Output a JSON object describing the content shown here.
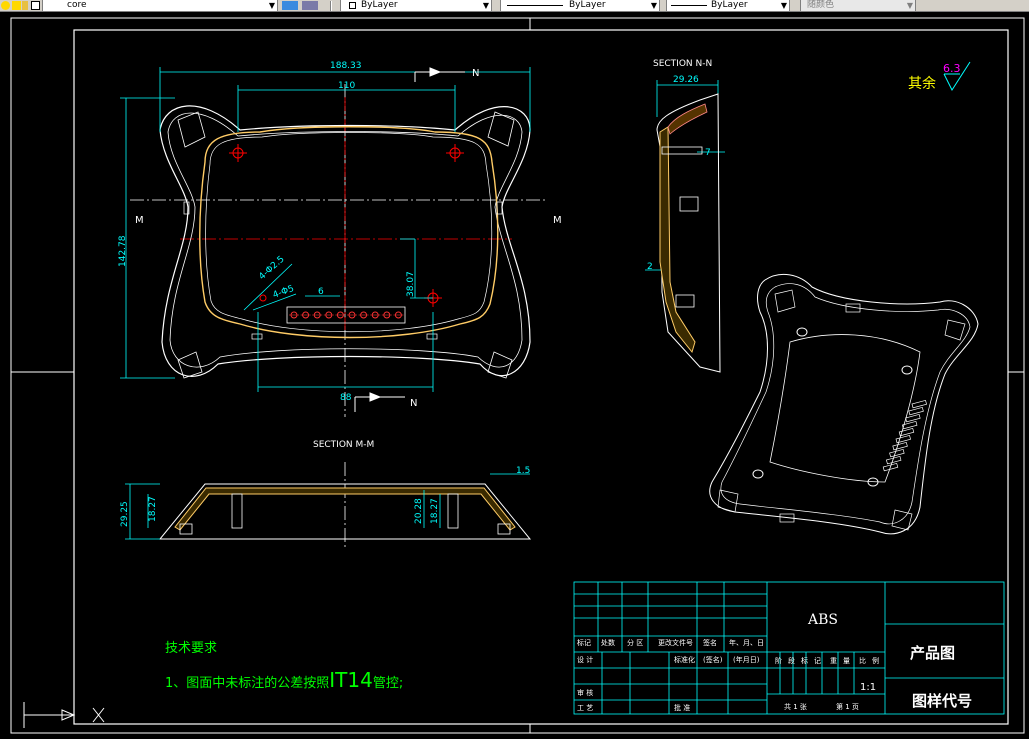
{
  "toolbar": {
    "layer_name": "core",
    "linetype_1": "ByLayer",
    "linetype_2": "ByLayer",
    "lineweight": "ByLayer",
    "plot_style": "随颜色"
  },
  "drawing": {
    "dimensions": {
      "overall_width": "188.33",
      "inner_width": "110",
      "bottom_width": "88",
      "overall_height": "142.78",
      "boss_offset": "38.07",
      "rib_pitch": "6",
      "hole_1": "4-Φ2.5",
      "hole_2": "4-Φ5"
    },
    "section_markers": {
      "n_top": "N",
      "n_bottom": "N",
      "m_left": "M",
      "m_right": "M"
    },
    "section_nn": {
      "title": "SECTION N-N",
      "width": "29.26",
      "thickness": "2",
      "angle": "7"
    },
    "section_mm": {
      "title": "SECTION M-M",
      "height_outer": "29.25",
      "height_inner_left": "18.27",
      "height_boss_1": "20.28",
      "height_boss_2": "18.27",
      "wall": "1.5"
    },
    "surface_finish": {
      "label": "其余",
      "value": "6.3"
    },
    "tech_requirements": {
      "heading": "技术要求",
      "item_1_prefix": "1、图面中未标注的公差按照",
      "item_1_grade": "IT14",
      "item_1_suffix": "管控;"
    },
    "title_block": {
      "material": "ABS",
      "drawing_name": "产品图",
      "drawing_code": "图样代号",
      "scale": "1:1",
      "row_labels": [
        "标记",
        "处数",
        "分 区",
        "更改文件号",
        "签名",
        "年、月、日"
      ],
      "design": "设 计",
      "standardize": "标准化",
      "sign": "(签名)",
      "date": "(年月日)",
      "stage_labels": [
        "阶",
        "段",
        "标",
        "记",
        "重",
        "量",
        "比",
        "例"
      ],
      "review": "审 核",
      "process": "工 艺",
      "approve": "批 准",
      "sheets_total": "共 1 张",
      "sheet_no": "第 1 页"
    }
  }
}
